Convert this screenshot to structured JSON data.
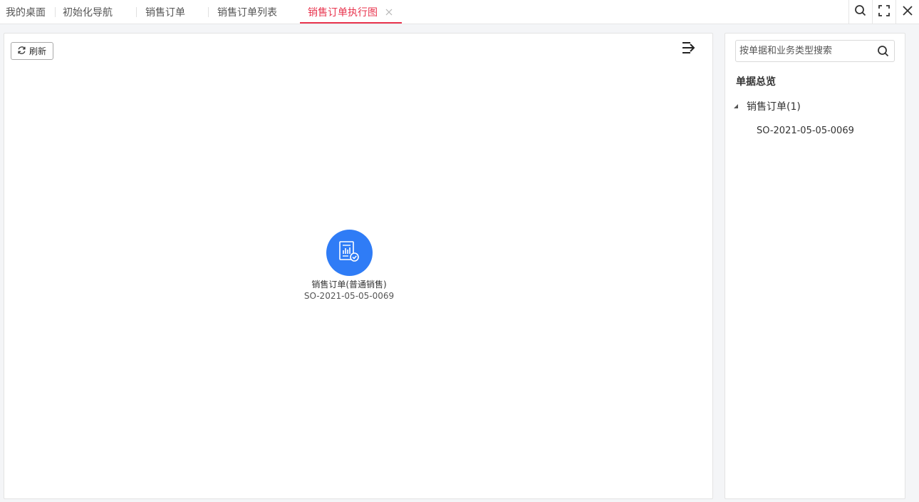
{
  "tabs": [
    {
      "label": "我的桌面",
      "active": false
    },
    {
      "label": "初始化导航",
      "active": false
    },
    {
      "label": "销售订单",
      "active": false
    },
    {
      "label": "销售订单列表",
      "active": false
    },
    {
      "label": "销售订单执行图",
      "active": true
    }
  ],
  "colors": {
    "accent": "#e8344e",
    "node_blue": "#2f7cf6"
  },
  "toolbar": {
    "refresh_label": "刷新"
  },
  "graph": {
    "node": {
      "name": "销售订单(普通销售)",
      "code": "SO-2021-05-05-0069",
      "icon": "document-chart-check-icon"
    }
  },
  "side": {
    "search_placeholder": "按单据和业务类型搜索",
    "title": "单据总览",
    "tree": {
      "label": "销售订单(1)",
      "children": [
        "SO-2021-05-05-0069"
      ]
    }
  }
}
